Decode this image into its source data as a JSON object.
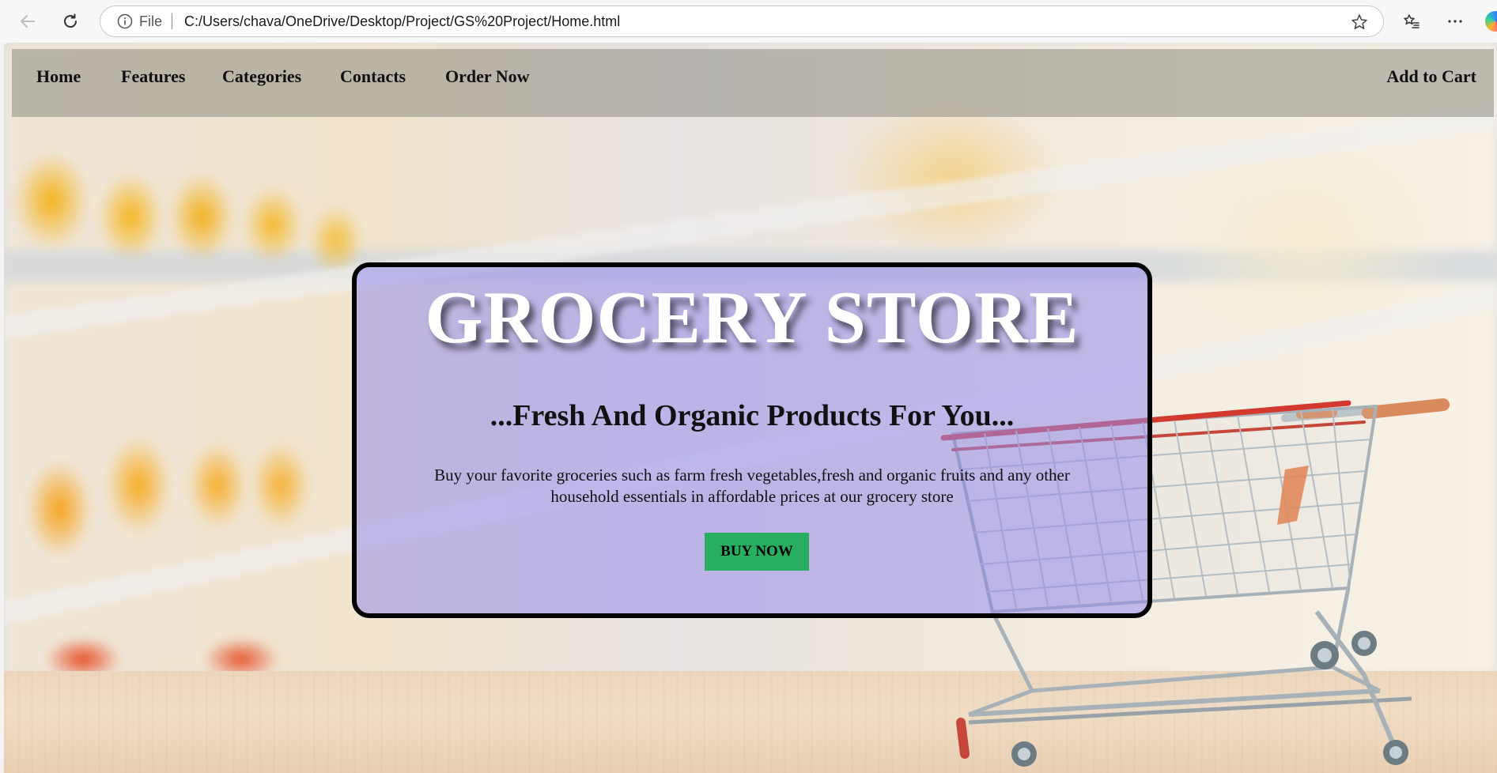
{
  "browser": {
    "scheme_label": "File",
    "url": "C:/Users/chava/OneDrive/Desktop/Project/GS%20Project/Home.html"
  },
  "site_nav": {
    "links": [
      "Home",
      "Features",
      "Categories",
      "Contacts",
      "Order Now"
    ],
    "cart_label": "Add to Cart"
  },
  "hero": {
    "title": "GROCERY STORE",
    "subtitle": "...Fresh And Organic Products For You...",
    "description_line1": "Buy your favorite groceries such as farm fresh vegetables,fresh and organic fruits and any other",
    "description_line2": "household essentials in affordable prices at our grocery store",
    "button_label": "BUY NOW",
    "button_color": "#27ae60",
    "card_tint": "#968cea"
  },
  "icons": [
    "back-arrow-icon",
    "refresh-icon",
    "info-icon",
    "star-icon",
    "favorites-icon",
    "more-icon",
    "copilot-icon"
  ]
}
